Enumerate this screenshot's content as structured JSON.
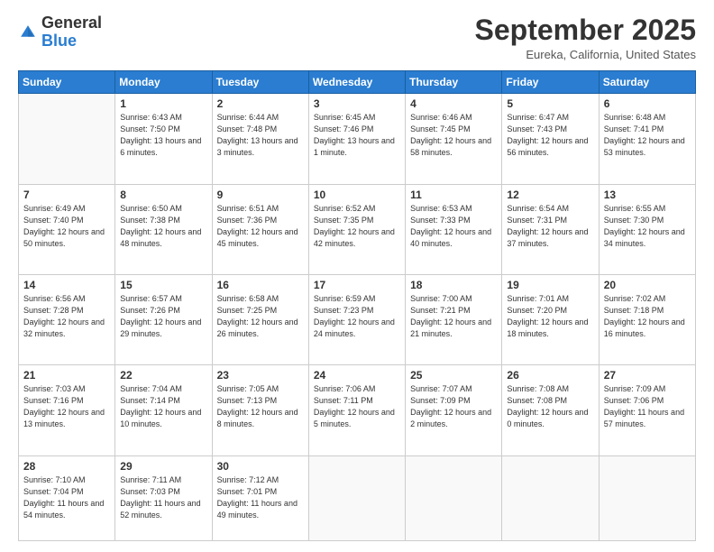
{
  "header": {
    "logo_general": "General",
    "logo_blue": "Blue",
    "month_title": "September 2025",
    "location": "Eureka, California, United States"
  },
  "days_of_week": [
    "Sunday",
    "Monday",
    "Tuesday",
    "Wednesday",
    "Thursday",
    "Friday",
    "Saturday"
  ],
  "weeks": [
    [
      {
        "day": "",
        "sunrise": "",
        "sunset": "",
        "daylight": ""
      },
      {
        "day": "1",
        "sunrise": "Sunrise: 6:43 AM",
        "sunset": "Sunset: 7:50 PM",
        "daylight": "Daylight: 13 hours and 6 minutes."
      },
      {
        "day": "2",
        "sunrise": "Sunrise: 6:44 AM",
        "sunset": "Sunset: 7:48 PM",
        "daylight": "Daylight: 13 hours and 3 minutes."
      },
      {
        "day": "3",
        "sunrise": "Sunrise: 6:45 AM",
        "sunset": "Sunset: 7:46 PM",
        "daylight": "Daylight: 13 hours and 1 minute."
      },
      {
        "day": "4",
        "sunrise": "Sunrise: 6:46 AM",
        "sunset": "Sunset: 7:45 PM",
        "daylight": "Daylight: 12 hours and 58 minutes."
      },
      {
        "day": "5",
        "sunrise": "Sunrise: 6:47 AM",
        "sunset": "Sunset: 7:43 PM",
        "daylight": "Daylight: 12 hours and 56 minutes."
      },
      {
        "day": "6",
        "sunrise": "Sunrise: 6:48 AM",
        "sunset": "Sunset: 7:41 PM",
        "daylight": "Daylight: 12 hours and 53 minutes."
      }
    ],
    [
      {
        "day": "7",
        "sunrise": "Sunrise: 6:49 AM",
        "sunset": "Sunset: 7:40 PM",
        "daylight": "Daylight: 12 hours and 50 minutes."
      },
      {
        "day": "8",
        "sunrise": "Sunrise: 6:50 AM",
        "sunset": "Sunset: 7:38 PM",
        "daylight": "Daylight: 12 hours and 48 minutes."
      },
      {
        "day": "9",
        "sunrise": "Sunrise: 6:51 AM",
        "sunset": "Sunset: 7:36 PM",
        "daylight": "Daylight: 12 hours and 45 minutes."
      },
      {
        "day": "10",
        "sunrise": "Sunrise: 6:52 AM",
        "sunset": "Sunset: 7:35 PM",
        "daylight": "Daylight: 12 hours and 42 minutes."
      },
      {
        "day": "11",
        "sunrise": "Sunrise: 6:53 AM",
        "sunset": "Sunset: 7:33 PM",
        "daylight": "Daylight: 12 hours and 40 minutes."
      },
      {
        "day": "12",
        "sunrise": "Sunrise: 6:54 AM",
        "sunset": "Sunset: 7:31 PM",
        "daylight": "Daylight: 12 hours and 37 minutes."
      },
      {
        "day": "13",
        "sunrise": "Sunrise: 6:55 AM",
        "sunset": "Sunset: 7:30 PM",
        "daylight": "Daylight: 12 hours and 34 minutes."
      }
    ],
    [
      {
        "day": "14",
        "sunrise": "Sunrise: 6:56 AM",
        "sunset": "Sunset: 7:28 PM",
        "daylight": "Daylight: 12 hours and 32 minutes."
      },
      {
        "day": "15",
        "sunrise": "Sunrise: 6:57 AM",
        "sunset": "Sunset: 7:26 PM",
        "daylight": "Daylight: 12 hours and 29 minutes."
      },
      {
        "day": "16",
        "sunrise": "Sunrise: 6:58 AM",
        "sunset": "Sunset: 7:25 PM",
        "daylight": "Daylight: 12 hours and 26 minutes."
      },
      {
        "day": "17",
        "sunrise": "Sunrise: 6:59 AM",
        "sunset": "Sunset: 7:23 PM",
        "daylight": "Daylight: 12 hours and 24 minutes."
      },
      {
        "day": "18",
        "sunrise": "Sunrise: 7:00 AM",
        "sunset": "Sunset: 7:21 PM",
        "daylight": "Daylight: 12 hours and 21 minutes."
      },
      {
        "day": "19",
        "sunrise": "Sunrise: 7:01 AM",
        "sunset": "Sunset: 7:20 PM",
        "daylight": "Daylight: 12 hours and 18 minutes."
      },
      {
        "day": "20",
        "sunrise": "Sunrise: 7:02 AM",
        "sunset": "Sunset: 7:18 PM",
        "daylight": "Daylight: 12 hours and 16 minutes."
      }
    ],
    [
      {
        "day": "21",
        "sunrise": "Sunrise: 7:03 AM",
        "sunset": "Sunset: 7:16 PM",
        "daylight": "Daylight: 12 hours and 13 minutes."
      },
      {
        "day": "22",
        "sunrise": "Sunrise: 7:04 AM",
        "sunset": "Sunset: 7:14 PM",
        "daylight": "Daylight: 12 hours and 10 minutes."
      },
      {
        "day": "23",
        "sunrise": "Sunrise: 7:05 AM",
        "sunset": "Sunset: 7:13 PM",
        "daylight": "Daylight: 12 hours and 8 minutes."
      },
      {
        "day": "24",
        "sunrise": "Sunrise: 7:06 AM",
        "sunset": "Sunset: 7:11 PM",
        "daylight": "Daylight: 12 hours and 5 minutes."
      },
      {
        "day": "25",
        "sunrise": "Sunrise: 7:07 AM",
        "sunset": "Sunset: 7:09 PM",
        "daylight": "Daylight: 12 hours and 2 minutes."
      },
      {
        "day": "26",
        "sunrise": "Sunrise: 7:08 AM",
        "sunset": "Sunset: 7:08 PM",
        "daylight": "Daylight: 12 hours and 0 minutes."
      },
      {
        "day": "27",
        "sunrise": "Sunrise: 7:09 AM",
        "sunset": "Sunset: 7:06 PM",
        "daylight": "Daylight: 11 hours and 57 minutes."
      }
    ],
    [
      {
        "day": "28",
        "sunrise": "Sunrise: 7:10 AM",
        "sunset": "Sunset: 7:04 PM",
        "daylight": "Daylight: 11 hours and 54 minutes."
      },
      {
        "day": "29",
        "sunrise": "Sunrise: 7:11 AM",
        "sunset": "Sunset: 7:03 PM",
        "daylight": "Daylight: 11 hours and 52 minutes."
      },
      {
        "day": "30",
        "sunrise": "Sunrise: 7:12 AM",
        "sunset": "Sunset: 7:01 PM",
        "daylight": "Daylight: 11 hours and 49 minutes."
      },
      {
        "day": "",
        "sunrise": "",
        "sunset": "",
        "daylight": ""
      },
      {
        "day": "",
        "sunrise": "",
        "sunset": "",
        "daylight": ""
      },
      {
        "day": "",
        "sunrise": "",
        "sunset": "",
        "daylight": ""
      },
      {
        "day": "",
        "sunrise": "",
        "sunset": "",
        "daylight": ""
      }
    ]
  ]
}
